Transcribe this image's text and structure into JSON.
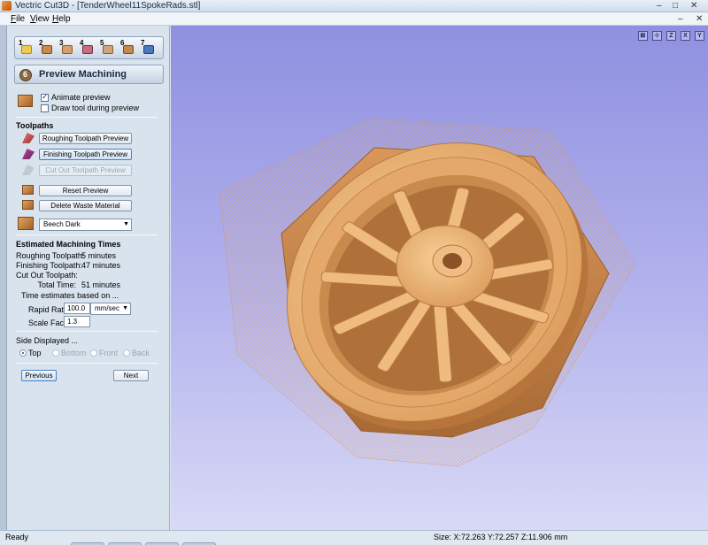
{
  "window": {
    "title": "Vectric Cut3D - [TenderWheel11SpokeRads.stl]",
    "minimize": "–",
    "maximize": "□",
    "close": "✕"
  },
  "menu": {
    "items": [
      "File",
      "View",
      "Help"
    ]
  },
  "steps": [
    "1",
    "2",
    "3",
    "4",
    "5",
    "6",
    "7"
  ],
  "panel": {
    "title": "Preview Machining",
    "title_step": "6",
    "animate_preview": {
      "label": "Animate preview",
      "checked": true
    },
    "draw_tool": {
      "label": "Draw tool during preview",
      "checked": false
    },
    "toolpaths_heading": "Toolpaths",
    "roughing_button": "Roughing Toolpath Preview",
    "finishing_button": "Finishing Toolpath Preview",
    "cutout_button": "Cut Out Toolpath Preview",
    "reset_button": "Reset Preview",
    "delete_waste_button": "Delete Waste Material",
    "material": "Beech Dark",
    "times_heading": "Estimated Machining Times",
    "times": [
      {
        "label": "Roughing Toolpath:",
        "value": "5 minutes"
      },
      {
        "label": "Finishing Toolpath:",
        "value": "47 minutes"
      },
      {
        "label": "Cut Out Toolpath:",
        "value": ""
      },
      {
        "label": "Total Time:",
        "value": "51 minutes"
      }
    ],
    "based_on": "Time estimates based on ...",
    "rapid_rate_label": "Rapid Rate",
    "rapid_rate_value": "100.0",
    "rapid_rate_unit": "mm/sec",
    "scale_factor_label": "Scale Factor",
    "scale_factor_value": "1.3",
    "side_heading": "Side Displayed ...",
    "sides": [
      {
        "label": "Top",
        "selected": true
      },
      {
        "label": "Bottom",
        "selected": false
      },
      {
        "label": "Front",
        "selected": false
      },
      {
        "label": "Back",
        "selected": false
      }
    ],
    "previous_button": "Previous",
    "next_button": "Next"
  },
  "view_icons": [
    {
      "name": "zoom-extents-icon",
      "glyph": "⊠"
    },
    {
      "name": "iso-view-icon",
      "glyph": "⊹"
    },
    {
      "name": "view-z-icon",
      "glyph": "Z"
    },
    {
      "name": "view-x-icon",
      "glyph": "X"
    },
    {
      "name": "view-y-icon",
      "glyph": "Y"
    }
  ],
  "status": {
    "text": "Ready",
    "size": "Size: X:72.263 Y:72.257 Z:11.906 mm"
  },
  "colors": {
    "wood_light": "#f2c088",
    "wood_mid": "#d9975a",
    "wood_dark": "#a86a35",
    "viewport_top": "#8f90e0",
    "viewport_bottom": "#d9d9f6"
  }
}
